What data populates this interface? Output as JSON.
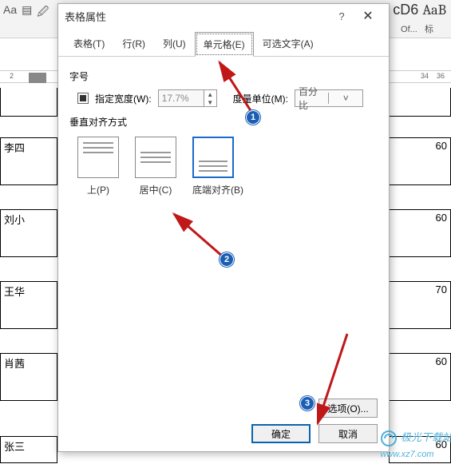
{
  "ribbon": {
    "right_bigtext": "AaB",
    "right_smalltext": "标",
    "right_prefix": "cD6",
    "right_suffix": "Of..."
  },
  "ruler": {
    "left_num": "2",
    "right_num_a": "34",
    "right_num_b": "36"
  },
  "bg_cells": {
    "name1": "李四",
    "name2": "刘小",
    "name3": "王华",
    "name4": "肖茜",
    "name5": "张三",
    "score1": "60",
    "score2": "60",
    "score3": "70",
    "score4": "60",
    "score5": "60"
  },
  "dialog": {
    "title": "表格属性",
    "tabs": {
      "table": "表格(T)",
      "row": "行(R)",
      "column": "列(U)",
      "cell": "单元格(E)",
      "alttext": "可选文字(A)"
    },
    "section_size": "字号",
    "specify_width_label": "指定宽度(W):",
    "width_value": "17.7%",
    "measure_label": "度量单位(M):",
    "measure_value": "百分比",
    "section_valign": "垂直对齐方式",
    "align": {
      "top": "上(P)",
      "center": "居中(C)",
      "bottom": "底端对齐(B)"
    },
    "options_btn": "选项(O)...",
    "ok_btn": "确定",
    "cancel_btn": "取消"
  },
  "badges": {
    "one": "1",
    "two": "2",
    "three": "3"
  },
  "watermark": {
    "line1": "极光下载站",
    "line2": "www.xz7.com"
  }
}
